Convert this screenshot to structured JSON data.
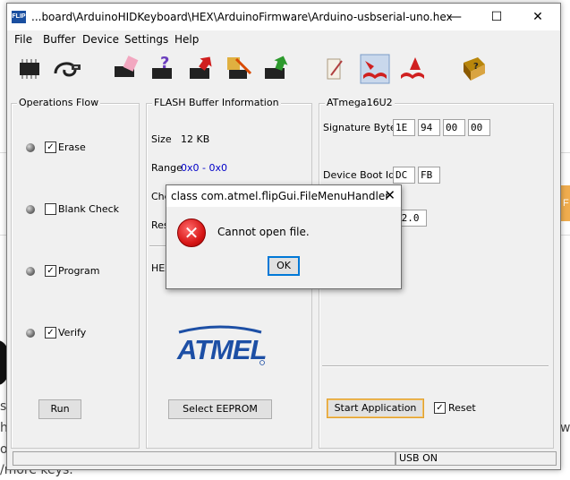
{
  "background_page": {
    "text_1": "s",
    "text_2": "he",
    "text_3": "od",
    "text_4": "/more keys.",
    "text_5": "wh",
    "orange_button": "F"
  },
  "window": {
    "title": "...board\\ArduinoHIDKeyboard\\HEX\\ArduinoFirmware\\Arduino-usbserial-uno.hex",
    "app_icon_text": "FLIP",
    "minimize": "—",
    "maximize": "☐",
    "close": "✕"
  },
  "menu": {
    "file": "File",
    "buffer": "Buffer",
    "device": "Device",
    "settings": "Settings",
    "help": "Help"
  },
  "toolbar": {
    "icons": [
      "select-device-icon",
      "usb-connect-icon",
      "erase-chip-icon",
      "blank-check-icon",
      "program-chip-icon",
      "verify-chip-icon",
      "load-hex-icon",
      "upload-icon",
      "parse-icon",
      "download-icon",
      "help-book-icon"
    ]
  },
  "operations": {
    "label": "Operations Flow",
    "erase": {
      "label": "Erase",
      "checked": true,
      "mark": "✓"
    },
    "blank_check": {
      "label": "Blank Check",
      "checked": false,
      "mark": ""
    },
    "program": {
      "label": "Program",
      "checked": true,
      "mark": "✓"
    },
    "verify": {
      "label": "Verify",
      "checked": true,
      "mark": "✓"
    },
    "run": "Run"
  },
  "flash": {
    "label": "FLASH Buffer Information",
    "size_label": "Size",
    "size_value": "12 KB",
    "range_label": "Range",
    "range_value": "0x0 - 0x0",
    "checksum_partial": "Che",
    "reset_partial": "Res",
    "hex_partial": "HEX",
    "select_eeprom": "Select EEPROM",
    "logo_text": "ATMEL"
  },
  "device": {
    "label": "ATmega16U2",
    "signature_label": "Signature Bytes",
    "signature": [
      "1E",
      "94",
      "00",
      "00"
    ],
    "boot_ids_label": "Device Boot Ids",
    "boot_ids": [
      "DC",
      "FB"
    ],
    "bootloader_partial": ".2.0",
    "start_application": "Start Application",
    "reset_label": "Reset",
    "reset_checked": true,
    "reset_mark": "✓"
  },
  "status": {
    "left": "",
    "right": "USB ON"
  },
  "dialog": {
    "title": "class com.atmel.flipGui.FileMenuHandler",
    "close": "✕",
    "icon": "error-icon",
    "icon_glyph": "✕",
    "message": "Cannot open file.",
    "ok": "OK"
  },
  "colors": {
    "atmel_blue": "#1d4fa5",
    "range_value": "#0000c8",
    "error_red": "#d81818"
  }
}
